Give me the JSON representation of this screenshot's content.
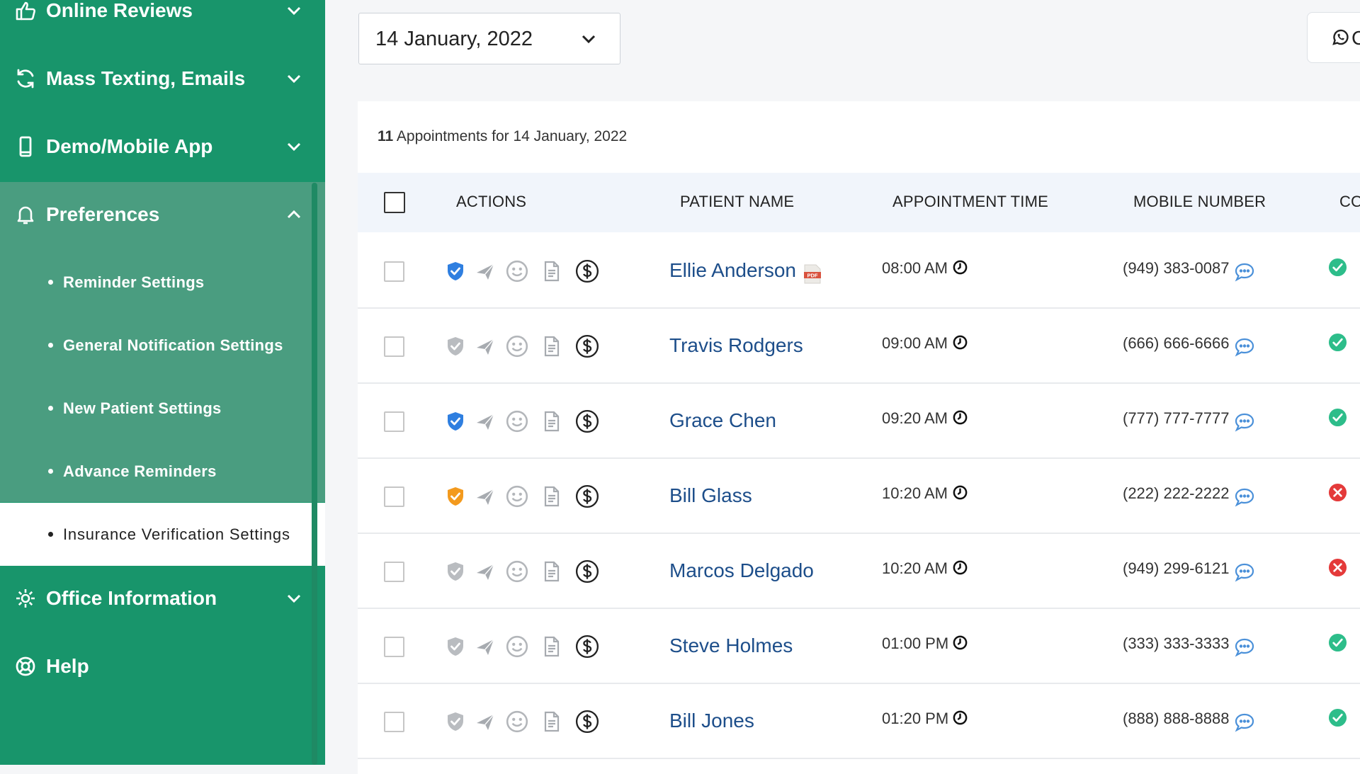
{
  "sidebar": {
    "items": [
      {
        "label": "Online Reviews",
        "icon": "thumbs-up-icon",
        "expanded": false
      },
      {
        "label": "Mass Texting, Emails",
        "icon": "refresh-icon",
        "expanded": false
      },
      {
        "label": "Demo/Mobile App",
        "icon": "mobile-icon",
        "expanded": false
      },
      {
        "label": "Preferences",
        "icon": "bell-icon",
        "expanded": true
      },
      {
        "label": "Office Information",
        "icon": "gear-icon",
        "expanded": false
      },
      {
        "label": "Help",
        "icon": "lifebuoy-icon"
      }
    ],
    "preferences_subitems": [
      {
        "label": "Reminder Settings"
      },
      {
        "label": "General Notification Settings"
      },
      {
        "label": "New Patient Settings"
      },
      {
        "label": "Advance Reminders"
      },
      {
        "label": "Insurance Verification Settings",
        "active": true
      }
    ]
  },
  "date_picker": {
    "value": "14 January, 2022"
  },
  "top_right_button": {
    "icon": "whatsapp-icon",
    "label_fragment": "C"
  },
  "summary": {
    "count": "11",
    "text": "Appointments for 14 January, 2022"
  },
  "table": {
    "columns": [
      "ACTIONS",
      "PATIENT NAME",
      "APPOINTMENT TIME",
      "MOBILE NUMBER",
      "CO"
    ],
    "rows": [
      {
        "name": "Ellie Anderson",
        "has_pdf": true,
        "pdf_label": "PDF",
        "time": "08:00 AM",
        "mobile": "(949) 383-0087",
        "shield": "verified",
        "status": "confirmed"
      },
      {
        "name": "Travis Rodgers",
        "has_pdf": false,
        "time": "09:00 AM",
        "mobile": "(666) 666-6666",
        "shield": "none",
        "status": "confirmed"
      },
      {
        "name": "Grace Chen",
        "has_pdf": false,
        "time": "09:20 AM",
        "mobile": "(777) 777-7777",
        "shield": "verified",
        "status": "confirmed"
      },
      {
        "name": "Bill Glass",
        "has_pdf": false,
        "time": "10:20 AM",
        "mobile": "(222) 222-2222",
        "shield": "pending",
        "status": "cancelled"
      },
      {
        "name": "Marcos Delgado",
        "has_pdf": false,
        "time": "10:20 AM",
        "mobile": "(949) 299-6121",
        "shield": "none",
        "status": "cancelled"
      },
      {
        "name": "Steve Holmes",
        "has_pdf": false,
        "time": "01:00 PM",
        "mobile": "(333) 333-3333",
        "shield": "none",
        "status": "confirmed"
      },
      {
        "name": "Bill Jones",
        "has_pdf": false,
        "time": "01:20 PM",
        "mobile": "(888) 888-8888",
        "shield": "none",
        "status": "confirmed"
      }
    ]
  },
  "colors": {
    "sidebar_bg": "#18956b",
    "submenu_bg": "#4a9d80",
    "shield_verified": "#2f7fe0",
    "shield_pending": "#f39a1e",
    "shield_none": "#b9bcc0",
    "status_confirmed": "#2dbd8a",
    "status_cancelled": "#e43a3a",
    "patient_link": "#1d4e8a",
    "chat_icon": "#4a90d9"
  },
  "icons": {
    "row_actions": [
      "shield-icon",
      "send-icon",
      "smile-icon",
      "document-icon",
      "dollar-icon"
    ],
    "time": "clock-icon",
    "mobile": "chat-bubble-icon",
    "status_confirmed": "check-circle-icon",
    "status_cancelled": "x-circle-icon",
    "dropdown": "chevron-down-icon"
  }
}
